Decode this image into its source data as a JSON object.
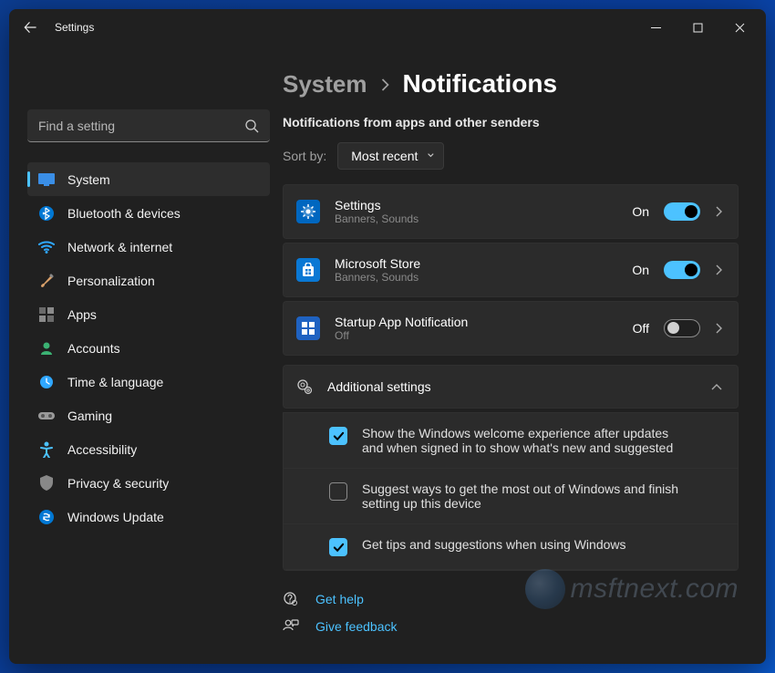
{
  "window": {
    "title": "Settings"
  },
  "search": {
    "placeholder": "Find a setting"
  },
  "nav": [
    {
      "label": "System"
    },
    {
      "label": "Bluetooth & devices"
    },
    {
      "label": "Network & internet"
    },
    {
      "label": "Personalization"
    },
    {
      "label": "Apps"
    },
    {
      "label": "Accounts"
    },
    {
      "label": "Time & language"
    },
    {
      "label": "Gaming"
    },
    {
      "label": "Accessibility"
    },
    {
      "label": "Privacy & security"
    },
    {
      "label": "Windows Update"
    }
  ],
  "breadcrumb": {
    "parent": "System",
    "title": "Notifications"
  },
  "section_label": "Notifications from apps and other senders",
  "sort": {
    "label": "Sort by:",
    "value": "Most recent"
  },
  "apps": [
    {
      "name": "Settings",
      "sub": "Banners, Sounds",
      "state": "On",
      "on": true
    },
    {
      "name": "Microsoft Store",
      "sub": "Banners, Sounds",
      "state": "On",
      "on": true
    },
    {
      "name": "Startup App Notification",
      "sub": "Off",
      "state": "Off",
      "on": false
    }
  ],
  "additional": {
    "title": "Additional settings"
  },
  "checks": [
    {
      "text": "Show the Windows welcome experience after updates and when signed in to show what's new and suggested",
      "checked": true
    },
    {
      "text": "Suggest ways to get the most out of Windows and finish setting up this device",
      "checked": false
    },
    {
      "text": "Get tips and suggestions when using Windows",
      "checked": true
    }
  ],
  "links": {
    "help": "Get help",
    "feedback": "Give feedback"
  },
  "watermark": "msftnext.com"
}
